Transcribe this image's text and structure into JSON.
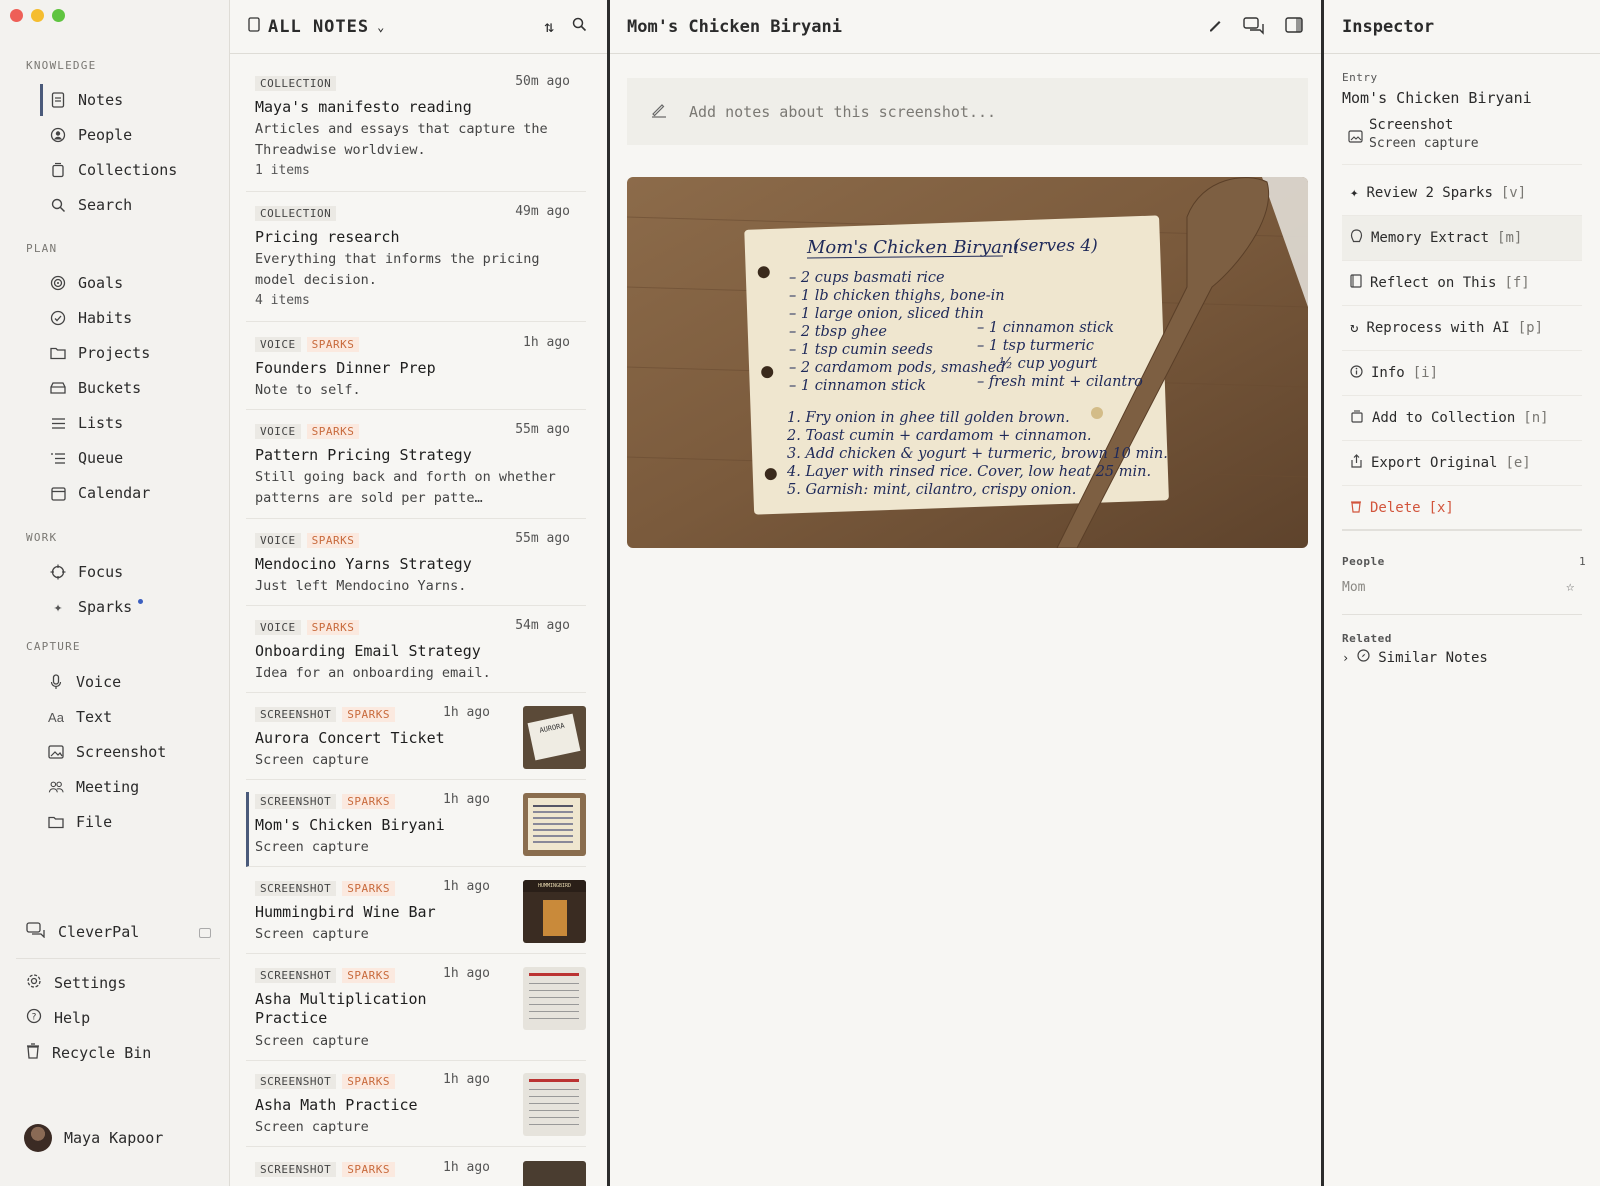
{
  "sidebar": {
    "knowledge_header": "KNOWLEDGE",
    "knowledge": [
      {
        "label": "Notes",
        "icon": "note-icon"
      },
      {
        "label": "People",
        "icon": "person-icon"
      },
      {
        "label": "Collections",
        "icon": "collection-icon"
      },
      {
        "label": "Search",
        "icon": "search-icon"
      }
    ],
    "plan_header": "PLAN",
    "plan": [
      {
        "label": "Goals",
        "icon": "target-icon"
      },
      {
        "label": "Habits",
        "icon": "habit-icon"
      },
      {
        "label": "Projects",
        "icon": "folder-icon"
      },
      {
        "label": "Buckets",
        "icon": "bucket-icon"
      },
      {
        "label": "Lists",
        "icon": "list-icon"
      },
      {
        "label": "Queue",
        "icon": "queue-icon"
      },
      {
        "label": "Calendar",
        "icon": "calendar-icon"
      }
    ],
    "work_header": "WORK",
    "work": [
      {
        "label": "Focus",
        "icon": "crosshair-icon"
      },
      {
        "label": "Sparks",
        "icon": "sparkle-icon"
      }
    ],
    "capture_header": "CAPTURE",
    "capture": [
      {
        "label": "Voice",
        "icon": "mic-icon"
      },
      {
        "label": "Text",
        "icon": "text-icon"
      },
      {
        "label": "Screenshot",
        "icon": "image-icon"
      },
      {
        "label": "Meeting",
        "icon": "people-icon"
      },
      {
        "label": "File",
        "icon": "folder-icon"
      }
    ],
    "cleverpal": "CleverPal",
    "settings": "Settings",
    "help": "Help",
    "recycle": "Recycle Bin",
    "user": "Maya Kapoor"
  },
  "list": {
    "title": "ALL NOTES",
    "notes": [
      {
        "tags": [
          "COLLECTION"
        ],
        "time": "50m ago",
        "title": "Maya's manifesto reading",
        "body": "Articles and essays that capture the Threadwise worldview.",
        "count": "1 items"
      },
      {
        "tags": [
          "COLLECTION"
        ],
        "time": "49m ago",
        "title": "Pricing research",
        "body": "Everything that informs the pricing model decision.",
        "count": "4 items"
      },
      {
        "tags": [
          "VOICE",
          "SPARKS"
        ],
        "time": "1h ago",
        "title": "Founders Dinner Prep",
        "body": "Note to self."
      },
      {
        "tags": [
          "VOICE",
          "SPARKS"
        ],
        "time": "55m ago",
        "title": "Pattern Pricing Strategy",
        "body": "Still going back and forth on whether patterns are sold per patte…"
      },
      {
        "tags": [
          "VOICE",
          "SPARKS"
        ],
        "time": "55m ago",
        "title": "Mendocino Yarns Strategy",
        "body": "Just left Mendocino Yarns."
      },
      {
        "tags": [
          "VOICE",
          "SPARKS"
        ],
        "time": "54m ago",
        "title": "Onboarding Email Strategy",
        "body": "Idea for an onboarding email."
      },
      {
        "tags": [
          "SCREENSHOT",
          "SPARKS"
        ],
        "time": "1h ago",
        "title": "Aurora Concert Ticket",
        "body": "Screen capture"
      },
      {
        "tags": [
          "SCREENSHOT",
          "SPARKS"
        ],
        "time": "1h ago",
        "title": "Mom's Chicken Biryani",
        "body": "Screen capture"
      },
      {
        "tags": [
          "SCREENSHOT",
          "SPARKS"
        ],
        "time": "1h ago",
        "title": "Hummingbird Wine Bar",
        "body": "Screen capture"
      },
      {
        "tags": [
          "SCREENSHOT",
          "SPARKS"
        ],
        "time": "1h ago",
        "title": "Asha Multiplication Practice",
        "body": "Screen capture"
      },
      {
        "tags": [
          "SCREENSHOT",
          "SPARKS"
        ],
        "time": "1h ago",
        "title": "Asha Math Practice",
        "body": "Screen capture"
      },
      {
        "tags": [
          "SCREENSHOT",
          "SPARKS"
        ],
        "time": "1h ago",
        "title": "",
        "body": ""
      }
    ],
    "thumb_aurora_text": "AURORA",
    "thumb_hummingbird_text": "HUMMINGBIRD"
  },
  "main": {
    "title": "Mom's Chicken Biryani",
    "notes_placeholder": "Add notes about this screenshot...",
    "recipe": {
      "title": "Mom's Chicken Biryani",
      "serves": "(serves 4)",
      "left": [
        "– 2 cups basmati rice",
        "– 1 lb chicken thighs, bone-in",
        "– 1 large onion, sliced thin",
        "– 2 tbsp ghee",
        "– 1 tsp cumin seeds",
        "– 2 cardamom pods, smashed",
        "– 1 cinnamon stick"
      ],
      "right": [
        "– 1 cinnamon stick",
        "– 1 tsp turmeric",
        "½ cup yogurt",
        "– fresh mint + cilantro"
      ],
      "steps": [
        "1. Fry onion in ghee till golden brown.",
        "2. Toast cumin + cardamom + cinnamon.",
        "3. Add chicken & yogurt + turmeric, brown 10 min.",
        "4. Layer with rinsed rice. Cover, low heat 25 min.",
        "5. Garnish: mint, cilantro, crispy onion."
      ]
    }
  },
  "inspector": {
    "title": "Inspector",
    "entry_label": "Entry",
    "entry_title": "Mom's Chicken Biryani",
    "entry_type": "Screenshot",
    "entry_sub": "Screen capture",
    "actions": [
      {
        "label": "Review 2 Sparks",
        "key": "[v]",
        "icon": "sparkle-icon"
      },
      {
        "label": "Memory Extract",
        "key": "[m]",
        "icon": "brain-icon"
      },
      {
        "label": "Reflect on This",
        "key": "[f]",
        "icon": "book-icon"
      },
      {
        "label": "Reprocess with AI",
        "key": "[p]",
        "icon": "refresh-icon"
      },
      {
        "label": "Info",
        "key": "[i]",
        "icon": "info-icon"
      },
      {
        "label": "Add to Collection",
        "key": "[n]",
        "icon": "collection-add-icon"
      },
      {
        "label": "Export Original",
        "key": "[e]",
        "icon": "export-icon"
      },
      {
        "label": "Delete",
        "key": "[x]",
        "icon": "trash-icon"
      }
    ],
    "people_label": "People",
    "people_count": "1",
    "person": "Mom",
    "related_label": "Related",
    "similar": "Similar Notes"
  },
  "colors": {
    "accent": "#4a5a7a",
    "spark": "#c86a3c",
    "danger": "#d2553c",
    "dot": "#3b5fc0"
  }
}
